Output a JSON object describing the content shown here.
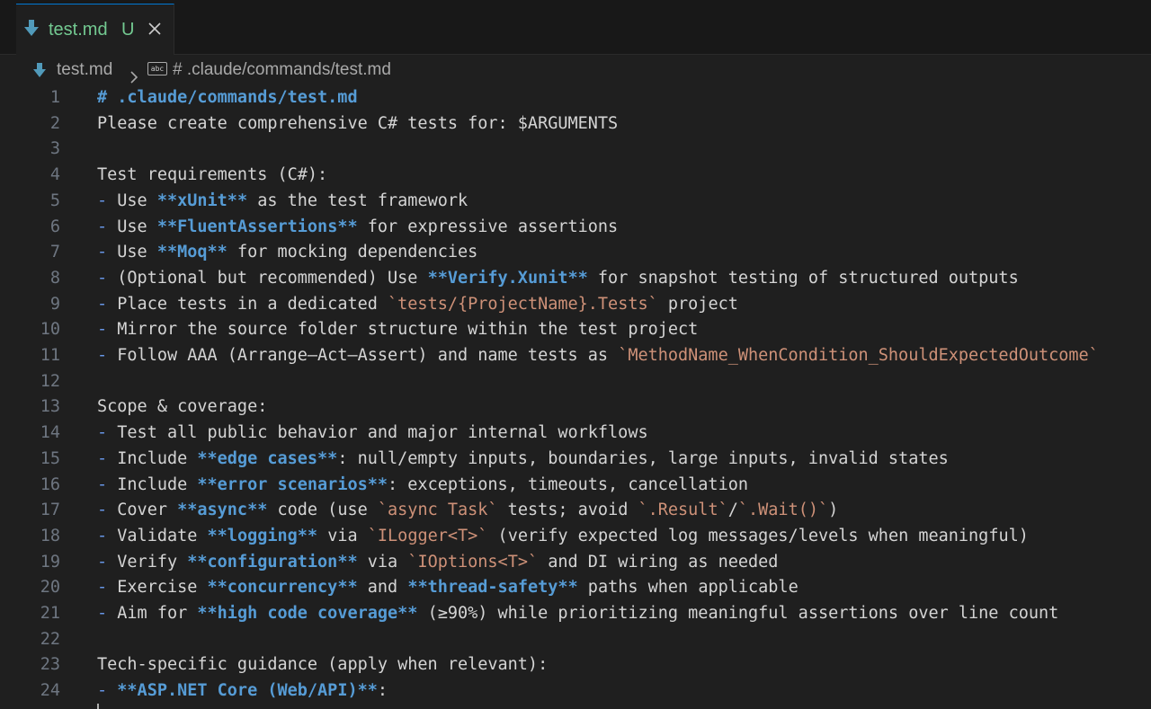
{
  "tab": {
    "filename": "test.md",
    "status": "U",
    "icon": "markdown-download-icon",
    "close_icon": "close-icon"
  },
  "breadcrumb": {
    "file": "test.md",
    "separator_icon": "chevron-right-icon",
    "symbol_icon": "abc",
    "symbol": "# .claude/commands/test.md"
  },
  "colors": {
    "background": "#1f1f1f",
    "tabbar": "#181818",
    "tab_text": "#73c991",
    "accent": "#0078d4",
    "line_number": "#6e7681",
    "text": "#d4d4d4",
    "heading": "#569cd6",
    "bullet": "#6796e6",
    "inline_code": "#ce9178"
  },
  "editor": {
    "lines": [
      {
        "n": "1",
        "segs": [
          {
            "t": "# .claude/commands/test.md",
            "s": "head"
          }
        ]
      },
      {
        "n": "2",
        "segs": [
          {
            "t": "Please create comprehensive C# tests for: $ARGUMENTS",
            "s": "plain"
          }
        ]
      },
      {
        "n": "3",
        "segs": []
      },
      {
        "n": "4",
        "segs": [
          {
            "t": "Test requirements (C#):",
            "s": "plain"
          }
        ]
      },
      {
        "n": "5",
        "segs": [
          {
            "t": "-",
            "s": "bullet"
          },
          {
            "t": " Use ",
            "s": "plain"
          },
          {
            "t": "**xUnit**",
            "s": "bold"
          },
          {
            "t": " as the test framework",
            "s": "plain"
          }
        ]
      },
      {
        "n": "6",
        "segs": [
          {
            "t": "-",
            "s": "bullet"
          },
          {
            "t": " Use ",
            "s": "plain"
          },
          {
            "t": "**FluentAssertions**",
            "s": "bold"
          },
          {
            "t": " for expressive assertions",
            "s": "plain"
          }
        ]
      },
      {
        "n": "7",
        "segs": [
          {
            "t": "-",
            "s": "bullet"
          },
          {
            "t": " Use ",
            "s": "plain"
          },
          {
            "t": "**Moq**",
            "s": "bold"
          },
          {
            "t": " for mocking dependencies",
            "s": "plain"
          }
        ]
      },
      {
        "n": "8",
        "segs": [
          {
            "t": "-",
            "s": "bullet"
          },
          {
            "t": " (Optional but recommended) Use ",
            "s": "plain"
          },
          {
            "t": "**Verify.Xunit**",
            "s": "bold"
          },
          {
            "t": " for snapshot testing of structured outputs",
            "s": "plain"
          }
        ]
      },
      {
        "n": "9",
        "segs": [
          {
            "t": "-",
            "s": "bullet"
          },
          {
            "t": " Place tests in a dedicated ",
            "s": "plain"
          },
          {
            "t": "`tests/{ProjectName}.Tests`",
            "s": "code"
          },
          {
            "t": " project",
            "s": "plain"
          }
        ]
      },
      {
        "n": "10",
        "segs": [
          {
            "t": "-",
            "s": "bullet"
          },
          {
            "t": " Mirror the source folder structure within the test project",
            "s": "plain"
          }
        ]
      },
      {
        "n": "11",
        "segs": [
          {
            "t": "-",
            "s": "bullet"
          },
          {
            "t": " Follow AAA (Arrange–Act–Assert) and name tests as ",
            "s": "plain"
          },
          {
            "t": "`MethodName_WhenCondition_ShouldExpectedOutcome`",
            "s": "code"
          }
        ]
      },
      {
        "n": "12",
        "segs": []
      },
      {
        "n": "13",
        "segs": [
          {
            "t": "Scope & coverage:",
            "s": "plain"
          }
        ]
      },
      {
        "n": "14",
        "segs": [
          {
            "t": "-",
            "s": "bullet"
          },
          {
            "t": " Test all public behavior and major internal workflows",
            "s": "plain"
          }
        ]
      },
      {
        "n": "15",
        "segs": [
          {
            "t": "-",
            "s": "bullet"
          },
          {
            "t": " Include ",
            "s": "plain"
          },
          {
            "t": "**edge cases**",
            "s": "bold"
          },
          {
            "t": ": null/empty inputs, boundaries, large inputs, invalid states",
            "s": "plain"
          }
        ]
      },
      {
        "n": "16",
        "segs": [
          {
            "t": "-",
            "s": "bullet"
          },
          {
            "t": " Include ",
            "s": "plain"
          },
          {
            "t": "**error scenarios**",
            "s": "bold"
          },
          {
            "t": ": exceptions, timeouts, cancellation",
            "s": "plain"
          }
        ]
      },
      {
        "n": "17",
        "segs": [
          {
            "t": "-",
            "s": "bullet"
          },
          {
            "t": " Cover ",
            "s": "plain"
          },
          {
            "t": "**async**",
            "s": "bold"
          },
          {
            "t": " code (use ",
            "s": "plain"
          },
          {
            "t": "`async Task`",
            "s": "code"
          },
          {
            "t": " tests; avoid ",
            "s": "plain"
          },
          {
            "t": "`.Result`",
            "s": "code"
          },
          {
            "t": "/",
            "s": "plain"
          },
          {
            "t": "`.Wait()`",
            "s": "code"
          },
          {
            "t": ")",
            "s": "plain"
          }
        ]
      },
      {
        "n": "18",
        "segs": [
          {
            "t": "-",
            "s": "bullet"
          },
          {
            "t": " Validate ",
            "s": "plain"
          },
          {
            "t": "**logging**",
            "s": "bold"
          },
          {
            "t": " via ",
            "s": "plain"
          },
          {
            "t": "`ILogger<T>`",
            "s": "code"
          },
          {
            "t": " (verify expected log messages/levels when meaningful)",
            "s": "plain"
          }
        ]
      },
      {
        "n": "19",
        "segs": [
          {
            "t": "-",
            "s": "bullet"
          },
          {
            "t": " Verify ",
            "s": "plain"
          },
          {
            "t": "**configuration**",
            "s": "bold"
          },
          {
            "t": " via ",
            "s": "plain"
          },
          {
            "t": "`IOptions<T>`",
            "s": "code"
          },
          {
            "t": " and DI wiring as needed",
            "s": "plain"
          }
        ]
      },
      {
        "n": "20",
        "segs": [
          {
            "t": "-",
            "s": "bullet"
          },
          {
            "t": " Exercise ",
            "s": "plain"
          },
          {
            "t": "**concurrency**",
            "s": "bold"
          },
          {
            "t": " and ",
            "s": "plain"
          },
          {
            "t": "**thread-safety**",
            "s": "bold"
          },
          {
            "t": " paths when applicable",
            "s": "plain"
          }
        ]
      },
      {
        "n": "21",
        "segs": [
          {
            "t": "-",
            "s": "bullet"
          },
          {
            "t": " Aim for ",
            "s": "plain"
          },
          {
            "t": "**high code coverage**",
            "s": "bold"
          },
          {
            "t": " (≥90%) while prioritizing meaningful assertions over line count",
            "s": "plain"
          }
        ]
      },
      {
        "n": "22",
        "segs": []
      },
      {
        "n": "23",
        "segs": [
          {
            "t": "Tech-specific guidance (apply when relevant):",
            "s": "plain"
          }
        ]
      },
      {
        "n": "24",
        "segs": [
          {
            "t": "-",
            "s": "bullet"
          },
          {
            "t": " ",
            "s": "plain"
          },
          {
            "t": "**ASP.NET Core (Web/API)**",
            "s": "bold"
          },
          {
            "t": ":",
            "s": "plain"
          }
        ]
      }
    ]
  }
}
